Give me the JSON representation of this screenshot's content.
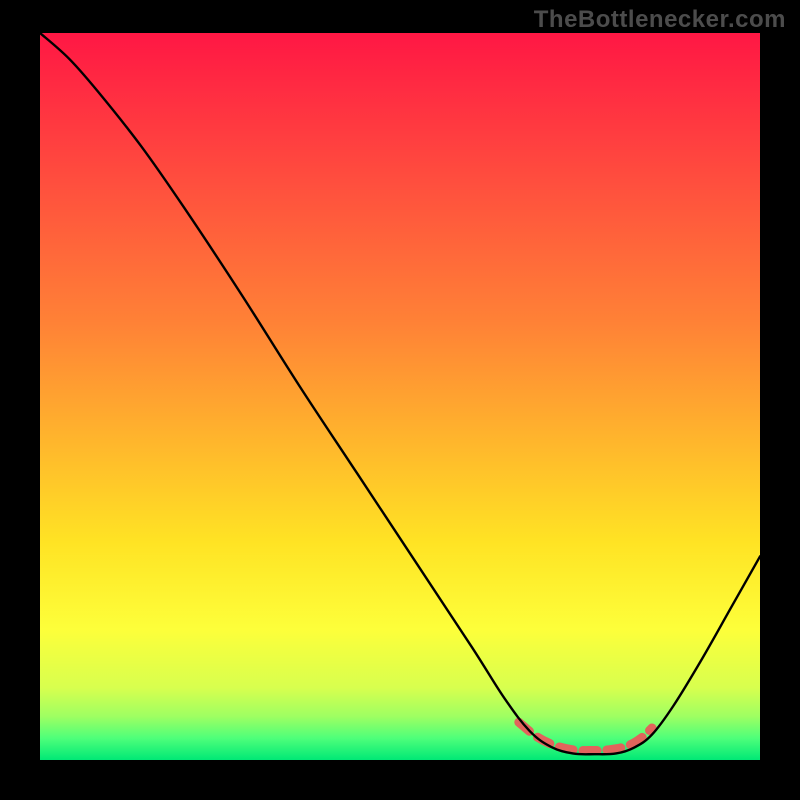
{
  "watermark": "TheBottlenecker.com",
  "chart_data": {
    "type": "line",
    "title": "",
    "xlabel": "",
    "ylabel": "",
    "xlim": [
      0,
      100
    ],
    "ylim": [
      0,
      100
    ],
    "background_gradient": {
      "stops": [
        {
          "pos": 0.0,
          "color": "#ff1744"
        },
        {
          "pos": 0.2,
          "color": "#ff4d3e"
        },
        {
          "pos": 0.4,
          "color": "#ff8236"
        },
        {
          "pos": 0.55,
          "color": "#ffb22d"
        },
        {
          "pos": 0.7,
          "color": "#ffe324"
        },
        {
          "pos": 0.82,
          "color": "#fdff3a"
        },
        {
          "pos": 0.9,
          "color": "#d8ff4e"
        },
        {
          "pos": 0.94,
          "color": "#9eff62"
        },
        {
          "pos": 0.97,
          "color": "#4eff7a"
        },
        {
          "pos": 1.0,
          "color": "#00e876"
        }
      ]
    },
    "series": [
      {
        "name": "bottleneck-curve",
        "color": "#000000",
        "stroke_width": 2.4,
        "points": [
          {
            "x": 0.0,
            "y": 100.0
          },
          {
            "x": 4.0,
            "y": 96.5
          },
          {
            "x": 8.0,
            "y": 92.0
          },
          {
            "x": 14.0,
            "y": 84.5
          },
          {
            "x": 20.0,
            "y": 76.0
          },
          {
            "x": 28.0,
            "y": 64.0
          },
          {
            "x": 36.0,
            "y": 51.5
          },
          {
            "x": 44.0,
            "y": 39.5
          },
          {
            "x": 52.0,
            "y": 27.5
          },
          {
            "x": 60.0,
            "y": 15.5
          },
          {
            "x": 64.5,
            "y": 8.5
          },
          {
            "x": 68.0,
            "y": 4.0
          },
          {
            "x": 71.0,
            "y": 1.8
          },
          {
            "x": 74.0,
            "y": 0.9
          },
          {
            "x": 77.0,
            "y": 0.8
          },
          {
            "x": 80.0,
            "y": 0.9
          },
          {
            "x": 82.5,
            "y": 1.7
          },
          {
            "x": 85.0,
            "y": 3.5
          },
          {
            "x": 88.0,
            "y": 7.5
          },
          {
            "x": 92.0,
            "y": 14.0
          },
          {
            "x": 96.0,
            "y": 21.0
          },
          {
            "x": 100.0,
            "y": 28.0
          }
        ]
      },
      {
        "name": "optimal-zone-marker",
        "color": "#e2645c",
        "stroke_width": 9,
        "dashed": true,
        "points": [
          {
            "x": 66.5,
            "y": 5.2
          },
          {
            "x": 69.0,
            "y": 3.2
          },
          {
            "x": 71.5,
            "y": 2.0
          },
          {
            "x": 74.0,
            "y": 1.4
          },
          {
            "x": 76.5,
            "y": 1.3
          },
          {
            "x": 79.0,
            "y": 1.4
          },
          {
            "x": 81.5,
            "y": 1.9
          },
          {
            "x": 83.5,
            "y": 3.0
          },
          {
            "x": 85.0,
            "y": 4.4
          }
        ]
      }
    ]
  }
}
